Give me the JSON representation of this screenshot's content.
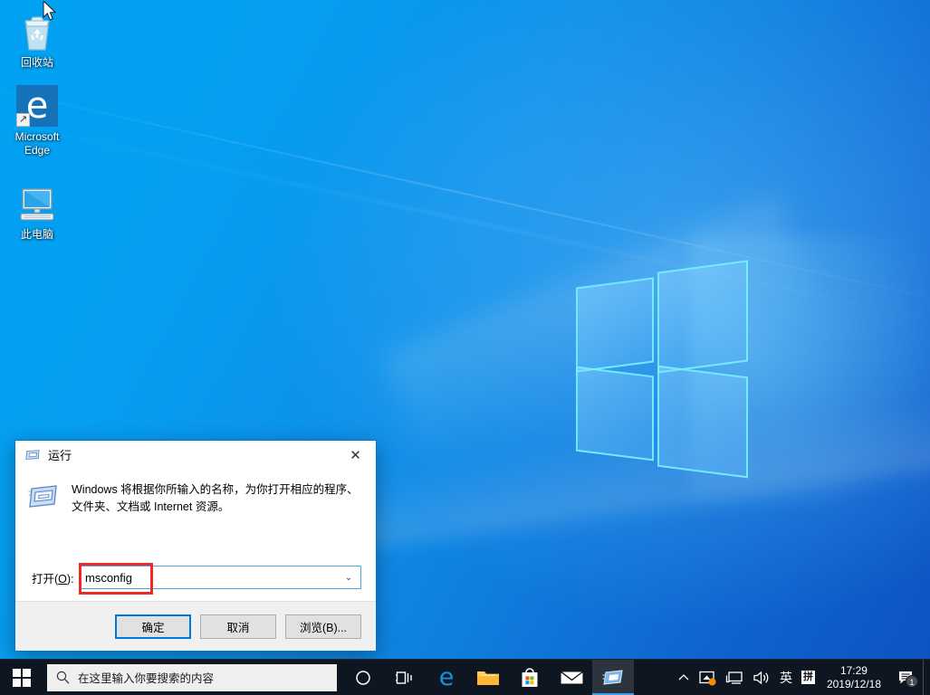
{
  "desktop": {
    "icons": [
      {
        "name": "recycle-bin",
        "label": "回收站"
      },
      {
        "name": "microsoft-edge",
        "label": "Microsoft\nEdge",
        "label_line1": "Microsoft",
        "label_line2": "Edge"
      },
      {
        "name": "this-pc",
        "label": "此电脑"
      }
    ],
    "wallpaper": {
      "accent_light": "#00a2f3",
      "accent_dark": "#0d51c0",
      "logo_stroke": "#78f5ff"
    }
  },
  "run_dialog": {
    "title": "运行",
    "title_icon": "run-window-icon",
    "close_label": "✕",
    "description": "Windows 将根据你所输入的名称，为你打开相应的程序、文件夹、文档或 Internet 资源。",
    "description_line1": "Windows 将根据你所输入的名称，为你打开相应的程序、",
    "description_line2": "文件夹、文档或 Internet 资源。",
    "open_label_prefix": "打开(",
    "open_label_accesskey": "O",
    "open_label_suffix": "):",
    "input_value": "msconfig",
    "input_placeholder": "",
    "combo_arrow": "⌄",
    "highlight_color": "#ef2929",
    "focus_color": "#0078d7",
    "buttons": [
      {
        "name": "ok-button",
        "label": "确定",
        "primary": true
      },
      {
        "name": "cancel-button",
        "label": "取消",
        "primary": false
      },
      {
        "name": "browse-button",
        "label": "浏览(B)...",
        "primary": false
      }
    ]
  },
  "taskbar": {
    "start_label": "start-button",
    "search": {
      "placeholder": "在这里输入你要搜索的内容",
      "icon": "search-icon"
    },
    "items": [
      {
        "name": "cortana",
        "icon": "circle-icon",
        "active": false
      },
      {
        "name": "task-view",
        "icon": "task-view-icon",
        "active": false
      },
      {
        "name": "microsoft-edge",
        "icon": "edge-icon",
        "active": false
      },
      {
        "name": "file-explorer",
        "icon": "folder-icon",
        "active": false
      },
      {
        "name": "microsoft-store",
        "icon": "store-bag-icon",
        "active": false
      },
      {
        "name": "mail",
        "icon": "envelope-icon",
        "active": false
      },
      {
        "name": "run-window",
        "icon": "run-window-icon",
        "active": true
      }
    ],
    "tray": {
      "overflow_label": "^",
      "items": [
        {
          "name": "onedrive-sync-icon",
          "badge_color": "#ff8c00"
        },
        {
          "name": "network-icon"
        },
        {
          "name": "volume-icon"
        }
      ],
      "ime_mode": "英",
      "ime_pinyin": "拼",
      "time": "17:29",
      "date": "2019/12/18",
      "notification_badge": "1",
      "notification_icon": "notification-icon"
    }
  }
}
